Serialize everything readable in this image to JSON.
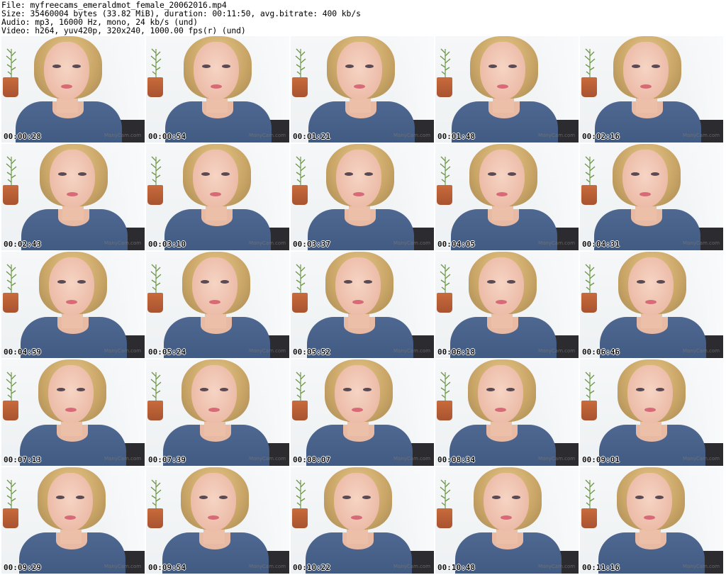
{
  "header": {
    "file": "File: myfreecams_emeraldmot_female_20062016.mp4",
    "size": "Size: 35460004 bytes (33.82 MiB), duration: 00:11:50, avg.bitrate: 400 kb/s",
    "audio": "Audio: mp3, 16000 Hz, mono, 24 kb/s (und)",
    "video": "Video: h264, yuv420p, 320x240, 1000.00 fps(r) (und)"
  },
  "watermark": "ManyCam.com",
  "thumbnails": [
    "00:00:28",
    "00:00:54",
    "00:01:21",
    "00:01:48",
    "00:02:16",
    "00:02:43",
    "00:03:10",
    "00:03:37",
    "00:04:05",
    "00:04:31",
    "00:04:59",
    "00:05:24",
    "00:05:52",
    "00:06:18",
    "00:06:46",
    "00:07:13",
    "00:07:39",
    "00:08:07",
    "00:08:34",
    "00:09:01",
    "00:09:29",
    "00:09:54",
    "00:10:22",
    "00:10:48",
    "00:11:16"
  ],
  "colors": {
    "shirt": "#4e6891",
    "hair": "#d9bb7c",
    "pot": "#c96b3c",
    "plant": "#6f9a4a",
    "background": "#ffffff"
  }
}
